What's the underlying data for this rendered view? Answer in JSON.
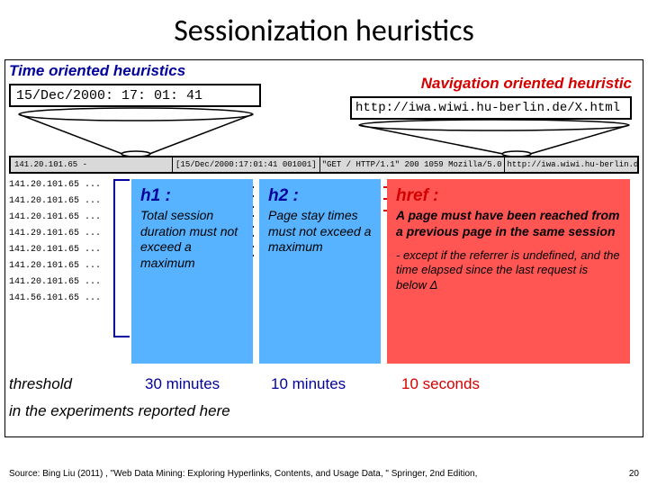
{
  "title": "Sessionization heuristics",
  "sections": {
    "left": "Time oriented heuristics",
    "right": "Navigation oriented heuristic"
  },
  "timestamp_box": "15/Dec/2000: 17: 01: 41",
  "url_box": "http://iwa.wiwi.hu-berlin.de/X.html",
  "logbar": {
    "ip": "141.20.101.65 -",
    "ts": "[15/Dec/2000:17:01:41 001001]",
    "mid": "\"GET / HTTP/1.1\" 200 1059 Mozilla/5.0",
    "url": "http://iwa.wiwi.hu-berlin.de/X.html"
  },
  "log_entries": [
    "141.20.101.65 ...",
    "141.20.101.65 ...",
    "141.20.101.65 ...",
    "141.29.101.65 ...",
    "141.20.101.65 ...",
    "141.20.101.65 ...",
    "141.20.101.65 ...",
    "141.56.101.65 ..."
  ],
  "heuristics": {
    "h1": {
      "label": "h1 :",
      "desc": "Total session duration must not exceed a maximum"
    },
    "h2": {
      "label": "h2 :",
      "desc": "Page stay times must not exceed a maximum"
    },
    "href": {
      "label": "href :",
      "desc": "A page must have been reached from a previous page in the same session",
      "extra": "- except if the referrer is undefined, and the time elapsed since the last request is below Δ"
    }
  },
  "threshold": {
    "label": "threshold",
    "h1": "30 minutes",
    "h2": "10 minutes",
    "href": "10 seconds"
  },
  "experiments_note": "in the experiments reported here",
  "footer": {
    "source": "Source: Bing Liu (2011) , \"Web Data Mining: Exploring Hyperlinks, Contents, and Usage Data, \" Springer, 2nd Edition,",
    "page": "20"
  }
}
